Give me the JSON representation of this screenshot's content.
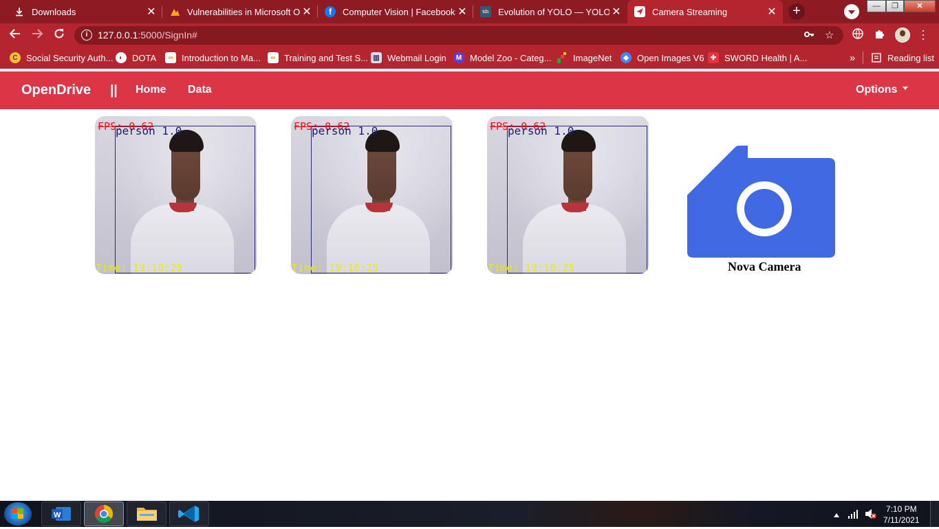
{
  "browser": {
    "tabs": [
      {
        "title": "Downloads",
        "favicon": "download-icon",
        "active": false
      },
      {
        "title": "Vulnerabilities in Microsoft Off",
        "favicon": "warning-icon",
        "active": false
      },
      {
        "title": "Computer Vision | Facebook",
        "favicon": "facebook-icon",
        "active": false
      },
      {
        "title": "Evolution of YOLO — YOLO ve",
        "favicon": "tds-icon",
        "favicon_text": "tds",
        "active": false
      },
      {
        "title": "Camera Streaming",
        "favicon": "send-icon",
        "active": true
      }
    ],
    "url_host": "127.0.0.1",
    "url_rest": ":5000/SignIn#",
    "bookmarks": [
      {
        "label": "Social Security Auth...",
        "icon": "ssa-icon"
      },
      {
        "label": "DOTA",
        "icon": "globe-icon"
      },
      {
        "label": "Introduction to Ma...",
        "icon": "colab-icon"
      },
      {
        "label": "Training and Test S...",
        "icon": "colab-icon"
      },
      {
        "label": "Webmail Login",
        "icon": "webmail-icon"
      },
      {
        "label": "Model Zoo - Categ...",
        "icon": "m-icon",
        "icon_text": "M"
      },
      {
        "label": "ImageNet",
        "icon": "imagenet-icon"
      },
      {
        "label": "Open Images V6",
        "icon": "open-images-icon"
      },
      {
        "label": "SWORD Health | A...",
        "icon": "sword-icon"
      }
    ],
    "overflow_label": "»",
    "reading_list": "Reading list",
    "window_controls": {
      "minimize": "—",
      "maximize": "❐",
      "close": "✕"
    }
  },
  "app": {
    "brand": "OpenDrive",
    "separator": "||",
    "nav": [
      {
        "label": "Home"
      },
      {
        "label": "Data"
      }
    ],
    "options_label": "Options",
    "streams": [
      {
        "fps": "FPS: 0.62",
        "detection": "person 1.0",
        "time": "Time: 19:10:25"
      },
      {
        "fps": "FPS: 0.62",
        "detection": "person 1.0",
        "time": "Time: 19:10:25"
      },
      {
        "fps": "FPS: 0.62",
        "detection": "person 1.0",
        "time": "Time: 19:10:25"
      }
    ],
    "new_camera_label": "Nova Camera",
    "camera_icon_color": "#4169e1",
    "accent_color": "#dc3545"
  },
  "taskbar": {
    "apps": [
      "word-icon",
      "chrome-icon",
      "file-explorer-icon",
      "vscode-icon"
    ],
    "active_app": "chrome-icon",
    "clock_time": "7:10 PM",
    "clock_date": "7/11/2021"
  }
}
